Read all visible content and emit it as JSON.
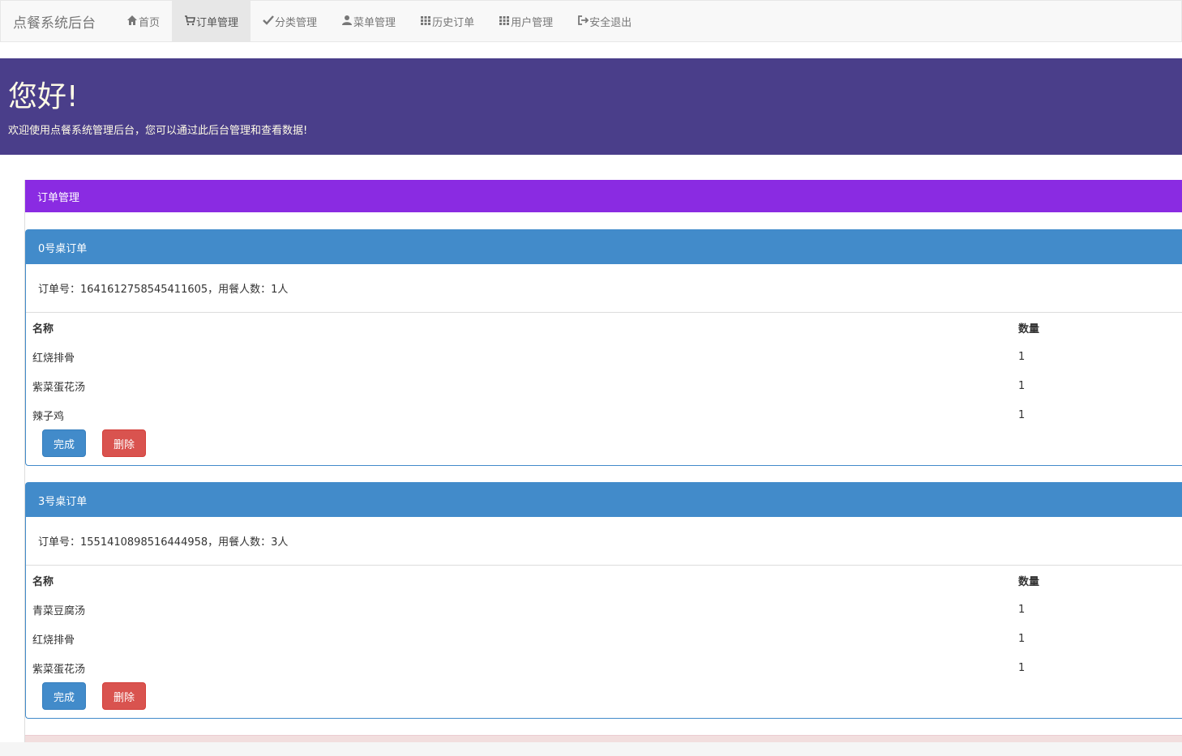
{
  "navbar": {
    "brand": "点餐系统后台",
    "items": [
      {
        "label": "首页",
        "icon": "home-icon"
      },
      {
        "label": "订单管理",
        "icon": "cart-icon",
        "active": true
      },
      {
        "label": "分类管理",
        "icon": "check-icon"
      },
      {
        "label": "菜单管理",
        "icon": "user-icon"
      },
      {
        "label": "历史订单",
        "icon": "grid-icon"
      },
      {
        "label": "用户管理",
        "icon": "grid-icon"
      },
      {
        "label": "安全退出",
        "icon": "logout-icon"
      }
    ]
  },
  "jumbotron": {
    "title": "您好!",
    "subtitle": "欢迎使用点餐系统管理后台，您可以通过此后台管理和查看数据!"
  },
  "section": {
    "title": "订单管理"
  },
  "orders": [
    {
      "title": "0号桌订单",
      "info": "订单号：1641612758545411605，用餐人数：1人",
      "col_name": "名称",
      "col_qty": "数量",
      "items": [
        {
          "name": "红烧排骨",
          "qty": "1"
        },
        {
          "name": "紫菜蛋花汤",
          "qty": "1"
        },
        {
          "name": "辣子鸡",
          "qty": "1"
        }
      ],
      "complete_label": "完成",
      "delete_label": "删除"
    },
    {
      "title": "3号桌订单",
      "info": "订单号：1551410898516444958，用餐人数：3人",
      "col_name": "名称",
      "col_qty": "数量",
      "items": [
        {
          "name": "青菜豆腐汤",
          "qty": "1"
        },
        {
          "name": "红烧排骨",
          "qty": "1"
        },
        {
          "name": "紫菜蛋花汤",
          "qty": "1"
        }
      ],
      "complete_label": "完成",
      "delete_label": "删除"
    }
  ],
  "colors": {
    "jumbotron_bg": "#4a3e8a",
    "section_bg": "#8a2be2",
    "panel_primary": "#428bca",
    "danger": "#d9534f"
  }
}
